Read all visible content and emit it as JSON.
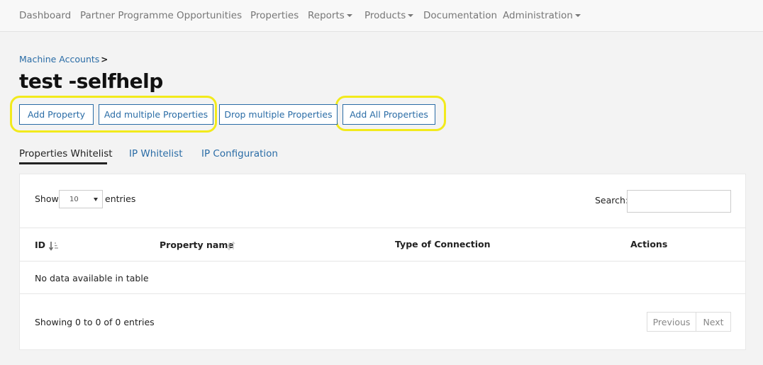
{
  "nav": {
    "items": [
      {
        "label": "Dashboard"
      },
      {
        "label": "Partner Programme"
      },
      {
        "label": "Opportunities"
      },
      {
        "label": "Properties"
      },
      {
        "label": "Reports"
      },
      {
        "label": "Products"
      },
      {
        "label": "Documentation"
      },
      {
        "label": "Administration"
      }
    ]
  },
  "breadcrumb": {
    "link": "Machine Accounts",
    "separator": ">"
  },
  "page": {
    "title": "test -selfhelp"
  },
  "actions": {
    "add_property": "Add Property",
    "add_multiple": "Add multiple Properties",
    "drop_multiple": "Drop multiple Properties",
    "add_all": "Add All Properties"
  },
  "tabs": [
    {
      "label": "Properties Whitelist",
      "active": true
    },
    {
      "label": "IP Whitelist",
      "active": false
    },
    {
      "label": "IP Configuration",
      "active": false
    }
  ],
  "table": {
    "length": {
      "show": "Show",
      "value": "10",
      "entries": "entries"
    },
    "search": {
      "label": "Search:",
      "value": ""
    },
    "columns": [
      "ID",
      "Property name",
      "Type of Connection",
      "Actions"
    ],
    "empty": "No data available in table",
    "info": "Showing 0 to 0 of 0 entries",
    "pagination": {
      "previous": "Previous",
      "next": "Next"
    }
  },
  "colors": {
    "link": "#2a6ca6",
    "highlight": "#f2ea1c"
  }
}
